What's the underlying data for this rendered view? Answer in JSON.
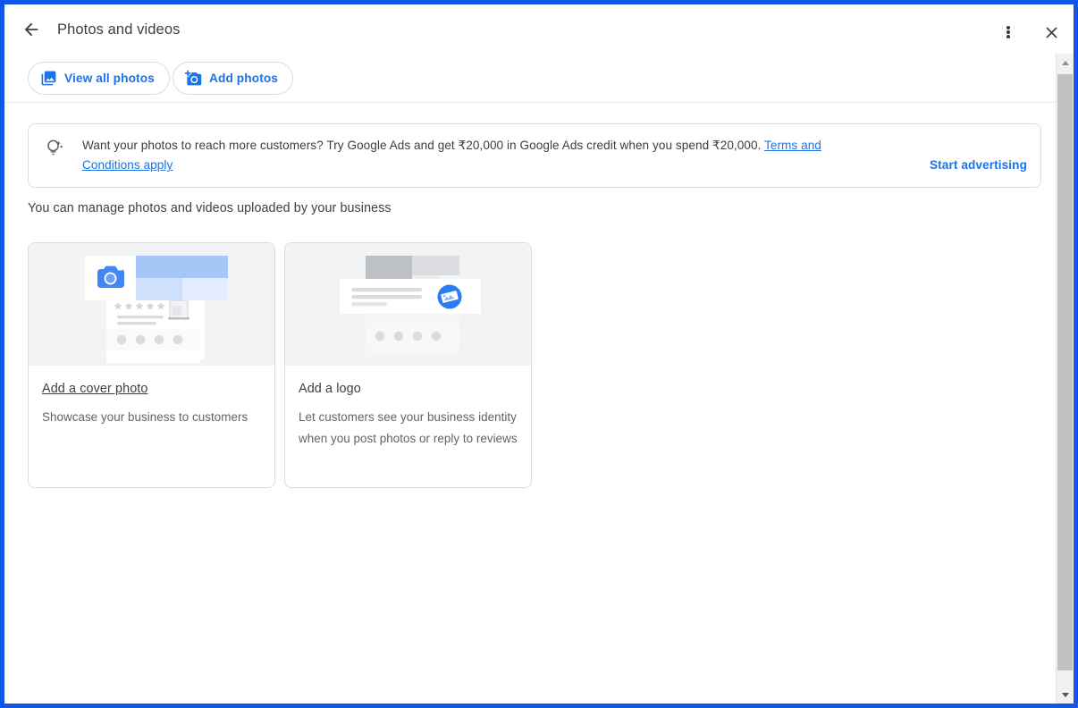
{
  "window": {
    "accent_border_color": "#1156e8"
  },
  "app_bar": {
    "title": "Photos and videos",
    "back_icon": "arrow-left-icon",
    "overflow_icon": "more-vert-icon",
    "close_icon": "close-icon"
  },
  "toolbar": {
    "chips": [
      {
        "label": "View all photos",
        "icon": "photo-library-icon"
      },
      {
        "label": "Add photos",
        "icon": "add-a-photo-icon"
      }
    ]
  },
  "ads_banner": {
    "icon": "lightbulb-idea-icon",
    "text_before_link": "Want your photos to reach more customers? Try Google Ads and get ₹20,000 in Google Ads credit when you spend ₹20,000. ",
    "link_label": "Terms and Conditions apply",
    "cta_label": "Start advertising",
    "link_color": "#1a73e8"
  },
  "main": {
    "subtitle": "You can manage photos and videos uploaded by your business",
    "cards": [
      {
        "title": "Add a cover photo",
        "description": "Showcase your business to customers",
        "illustration": "cover-photo-illustration",
        "title_underlined": true
      },
      {
        "title": "Add a logo",
        "description": "Let customers see your business identity when you post photos or reply to reviews",
        "illustration": "logo-illustration",
        "title_underlined": false
      }
    ]
  },
  "scrollbar": {
    "up_arrow_icon": "scroll-up-arrow-icon",
    "down_arrow_icon": "scroll-down-arrow-icon",
    "thumb_name": "scrollbar-thumb"
  }
}
